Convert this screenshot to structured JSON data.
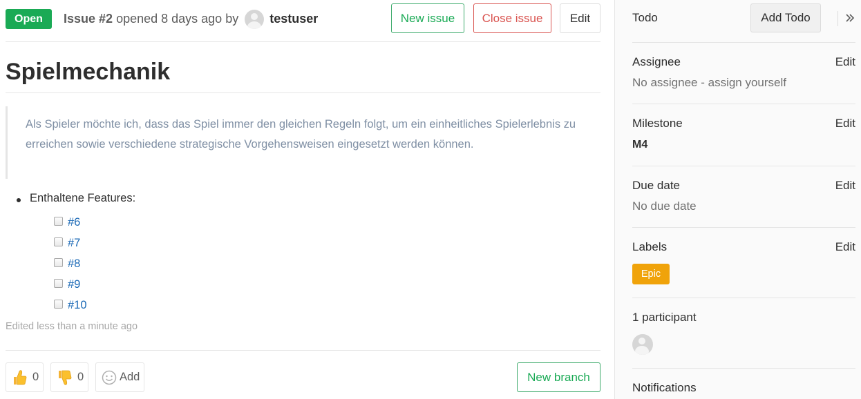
{
  "issue": {
    "status": "Open",
    "number_label": "Issue #2",
    "opened_text": "opened 8 days ago by",
    "author": "testuser",
    "title": "Spielmechanik",
    "description": "Als Spieler möchte ich, dass das Spiel immer den gleichen Regeln folgt, um ein einheitliches Spielerlebnis zu erreichen sowie verschiedene strategische Vorgehensweisen eingesetzt werden können.",
    "features_label": "Enthaltene Features:",
    "tasks": [
      "#6",
      "#7",
      "#8",
      "#9",
      "#10"
    ],
    "edited_text": "Edited less than a minute ago"
  },
  "actions": {
    "new_issue": "New issue",
    "close_issue": "Close issue",
    "edit": "Edit",
    "new_branch": "New branch"
  },
  "awards": {
    "thumbs_up_count": "0",
    "thumbs_down_count": "0",
    "add_label": "Add"
  },
  "sidebar": {
    "todo_title": "Todo",
    "add_todo": "Add Todo",
    "assignee_title": "Assignee",
    "assignee_value": "No assignee - assign yourself",
    "milestone_title": "Milestone",
    "milestone_value": "M4",
    "due_date_title": "Due date",
    "due_date_value": "No due date",
    "labels_title": "Labels",
    "label_epic": "Epic",
    "participants_title": "1 participant",
    "notifications_title": "Notifications",
    "edit_label": "Edit"
  },
  "colors": {
    "open_badge": "#1aaa55",
    "close_red": "#d9534f",
    "link_blue": "#1b69b6",
    "epic_label": "#f0a30a"
  },
  "icons": [
    "thumbs-up-icon",
    "thumbs-down-icon",
    "smiley-icon",
    "collapse-sidebar-icon",
    "avatar-icon"
  ]
}
